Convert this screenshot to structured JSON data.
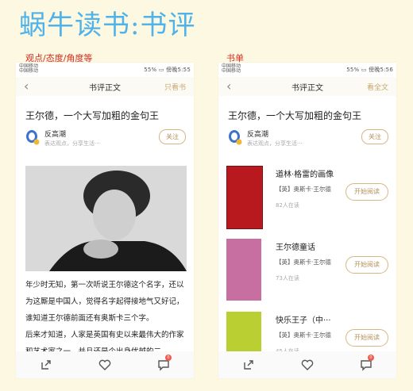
{
  "page_title": "蜗牛读书:书评",
  "captions": {
    "left": "观点/态度/角度等",
    "right": "书单"
  },
  "status_bar": {
    "carrier_1": "中国移动",
    "carrier_2": "中国移动",
    "left_time": "55% ▭ 傍晚5:55",
    "right_time": "55% ▭ 傍晚5:56"
  },
  "left_phone": {
    "nav": {
      "back": "‹",
      "title": "书评正文",
      "right": "只看书"
    },
    "article_title": "王尔德，一个大写加粗的金句王",
    "author": {
      "name": "反高潮",
      "subtitle": "表达观点，分享生活···",
      "follow": "关注"
    },
    "paragraphs": [
      "年少时无知，第一次听说王尔德这个名字，还以为这厮是中国人，觉得名字起得接地气又好记，谁知道王尔德前面还有奥斯卡三个字。",
      "后来才知道，人家是英国有史以来最伟大的作家和艺术家之一，并且还是个出身优越的二"
    ],
    "badge_count": "0"
  },
  "right_phone": {
    "nav": {
      "back": "‹",
      "title": "书评正文",
      "right": "看全文"
    },
    "article_title": "王尔德，一个大写加粗的金句王",
    "author": {
      "name": "反高潮",
      "subtitle": "表达观点，分享生活···",
      "follow": "关注"
    },
    "books": [
      {
        "title": "道林·格雷的画像",
        "author": "【英】奥斯卡·王尔德",
        "count": "82人在读",
        "button": "开始阅读",
        "cover_color": "#b8191f"
      },
      {
        "title": "王尔德童话",
        "author": "【英】奥斯卡·王尔德",
        "count": "73人在读",
        "button": "开始阅读",
        "cover_color": "#c66fa0"
      },
      {
        "title": "快乐王子（中···",
        "author": "【英】奥斯卡·王尔德",
        "count": "45人在读",
        "button": "开始阅读",
        "cover_color": "#b9cf32"
      }
    ],
    "badge_count": "0"
  }
}
